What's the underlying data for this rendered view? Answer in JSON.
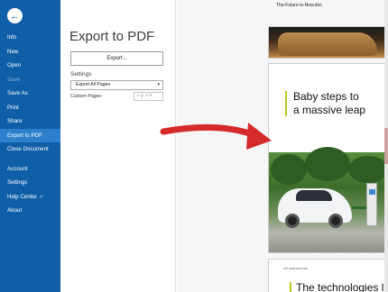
{
  "window": {
    "document_title": "The-Future-is-Now.doc"
  },
  "sidebar": {
    "back_icon": "back-arrow-icon",
    "items": [
      {
        "label": "Info",
        "state": "normal"
      },
      {
        "label": "New",
        "state": "normal"
      },
      {
        "label": "Open",
        "state": "normal"
      },
      {
        "label": "Save",
        "state": "disabled"
      },
      {
        "label": "Save As",
        "state": "normal"
      },
      {
        "label": "Print",
        "state": "normal"
      },
      {
        "label": "Share",
        "state": "normal"
      },
      {
        "label": "Export to PDF",
        "state": "active"
      },
      {
        "label": "Close Document",
        "state": "normal"
      },
      {
        "label": "Account",
        "state": "normal"
      },
      {
        "label": "Settings",
        "state": "normal"
      },
      {
        "label": "Help Center",
        "state": "normal",
        "icon": "external-link-icon"
      },
      {
        "label": "About",
        "state": "normal"
      }
    ]
  },
  "export_panel": {
    "title": "Export to PDF",
    "export_button": "Export...",
    "settings_label": "Settings",
    "pages_select": "Export All Pages",
    "custom_pages_label": "Custom Pages:",
    "custom_pages_placeholder": "e.g. 1-5"
  },
  "preview": {
    "page2_headline_line1": "Baby steps to",
    "page2_headline_line2": "a massive leap",
    "page3_brand": "ovi instruments",
    "page3_headline": "The technologies lea"
  },
  "colors": {
    "sidebar_bg": "#0f5fa8",
    "sidebar_active": "#2d80cc",
    "accent": "#b8c81e",
    "annotation_arrow": "#d42a2a"
  }
}
